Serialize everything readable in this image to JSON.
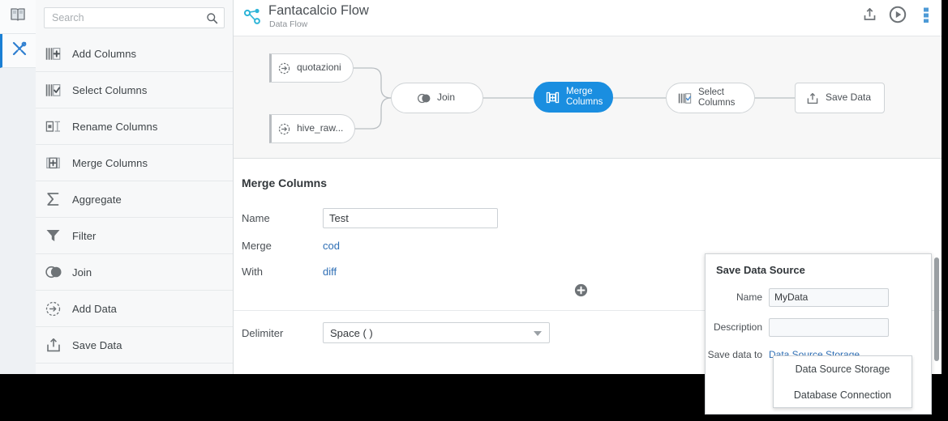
{
  "window": {
    "rail": {
      "tabs": [
        {
          "name": "book-icon",
          "label": "Library"
        },
        {
          "name": "tools-icon",
          "label": "Tools",
          "active": true
        }
      ]
    },
    "sidebar": {
      "search": {
        "value": "",
        "placeholder": "Search",
        "icon": "search-icon"
      },
      "items": [
        {
          "label": "Add Columns",
          "icon": "add-columns-icon"
        },
        {
          "label": "Select Columns",
          "icon": "select-columns-icon"
        },
        {
          "label": "Rename Columns",
          "icon": "rename-columns-icon"
        },
        {
          "label": "Merge Columns",
          "icon": "merge-columns-icon"
        },
        {
          "label": "Aggregate",
          "icon": "sigma-icon"
        },
        {
          "label": "Filter",
          "icon": "funnel-icon"
        },
        {
          "label": "Join",
          "icon": "join-icon"
        },
        {
          "label": "Add Data",
          "icon": "add-data-icon"
        },
        {
          "label": "Save Data",
          "icon": "save-data-icon"
        }
      ]
    },
    "header": {
      "logo_icon": "flow-graph-icon",
      "title": "Fantacalcio Flow",
      "subtitle": "Data Flow",
      "actions": [
        {
          "name": "export-button",
          "icon": "upload-icon"
        },
        {
          "name": "run-button",
          "icon": "play-icon"
        },
        {
          "name": "overflow-menu-button",
          "icon": "more-vertical-icon"
        }
      ]
    },
    "canvas": {
      "nodes": [
        {
          "id": "quotazioni",
          "label": "quotazioni",
          "icon": "add-data-icon",
          "shape": "data-node",
          "selected": false
        },
        {
          "id": "hive_raw",
          "label": "hive_raw...",
          "icon": "add-data-icon",
          "shape": "data-node",
          "selected": false
        },
        {
          "id": "join",
          "label": "Join",
          "icon": "join-icon",
          "shape": "pill",
          "selected": false
        },
        {
          "id": "merge_columns",
          "label": "Merge\nColumns",
          "icon": "merge-columns-icon",
          "shape": "pill",
          "selected": true
        },
        {
          "id": "select_columns",
          "label": "Select\nColumns",
          "icon": "select-columns-icon",
          "shape": "pill",
          "selected": false
        },
        {
          "id": "save_data",
          "label": "Save Data",
          "icon": "save-data-icon",
          "shape": "rect",
          "selected": false
        }
      ],
      "selected_color": "#1a8ee0",
      "background": "#f7f7f7"
    },
    "panel": {
      "title": "Merge Columns",
      "name_label": "Name",
      "name_value": "Test",
      "merge_label": "Merge",
      "merge_value": "cod",
      "with_label": "With",
      "with_value": "diff",
      "add_icon": "add-circle-icon",
      "delimiter_label": "Delimiter",
      "delimiter_value": "Space ( )",
      "delimiter_caret": "chevron-down-icon"
    }
  },
  "popup": {
    "title": "Save Data Source",
    "name_label": "Name",
    "name_value": "MyData",
    "name_placeholder": "",
    "description_label": "Description",
    "description_value": "",
    "description_placeholder": "",
    "save_to_label": "Save data to",
    "save_to_value": "Data Source Storage",
    "dropdown_options": [
      "Data Source Storage",
      "Database Connection"
    ]
  }
}
